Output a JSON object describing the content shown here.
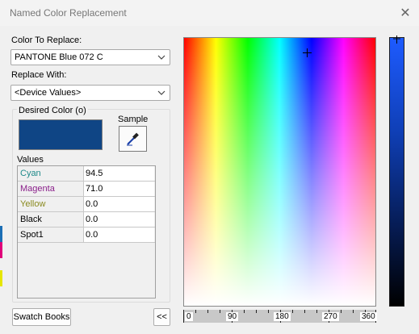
{
  "window": {
    "title": "Named Color Replacement"
  },
  "replace": {
    "label": "Color To Replace:",
    "value": "PANTONE Blue 072 C"
  },
  "replace_with": {
    "label": "Replace With:",
    "value": "<Device Values>"
  },
  "desired": {
    "label": "Desired Color (o)",
    "swatch_color": "#0f4585"
  },
  "sample": {
    "label": "Sample"
  },
  "values": {
    "label": "Values",
    "rows": [
      {
        "name": "Cyan",
        "value": "94.5",
        "color": "#1f8a8a"
      },
      {
        "name": "Magenta",
        "value": "71.0",
        "color": "#8a1f8a"
      },
      {
        "name": "Yellow",
        "value": "0.0",
        "color": "#8a8a1f"
      },
      {
        "name": "Black",
        "value": "0.0",
        "color": "#000000"
      },
      {
        "name": "Spot1",
        "value": "0.0",
        "color": "#000000"
      }
    ]
  },
  "buttons": {
    "swatch_books": "Swatch Books",
    "collapse": "<<"
  },
  "hue_ruler": {
    "labels": [
      "0",
      "90",
      "180",
      "270",
      "360"
    ]
  }
}
